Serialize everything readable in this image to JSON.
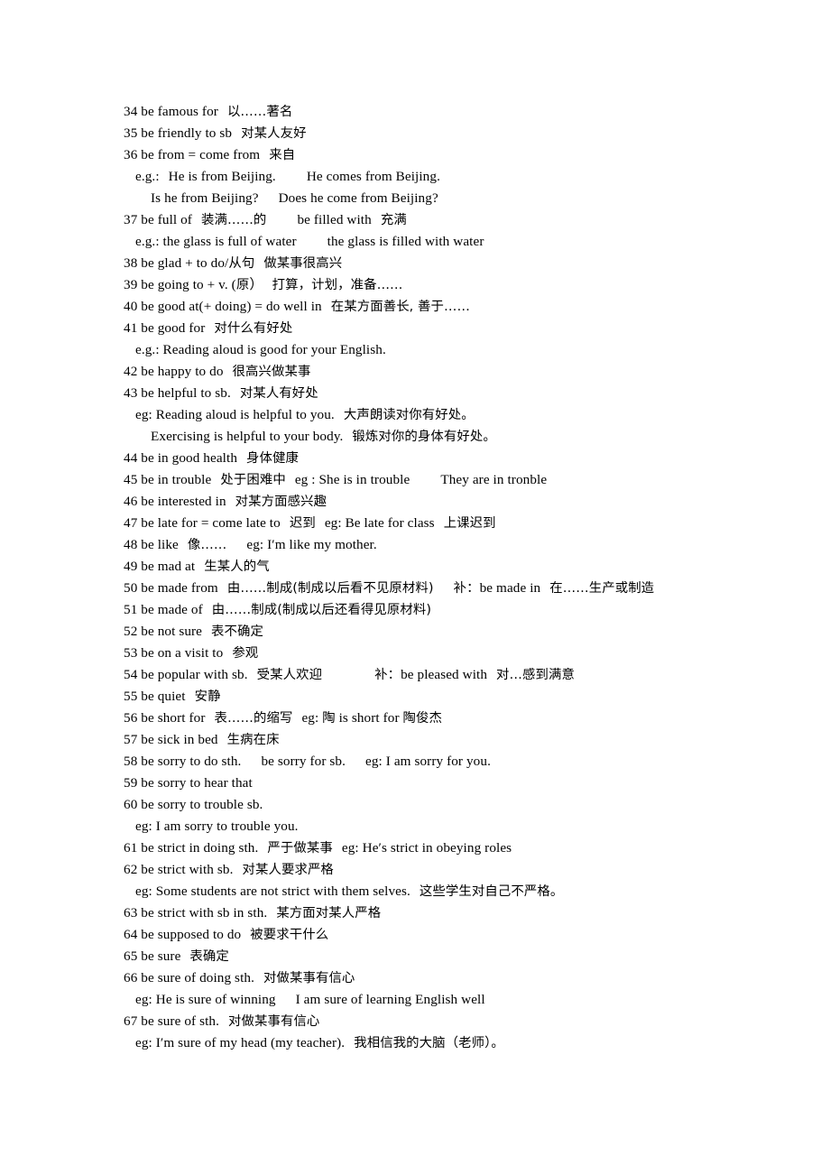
{
  "document": {
    "type": "english-chinese-phrase-list",
    "entries": [
      {
        "num": "34",
        "en": "be famous for",
        "zh": "以……著名"
      },
      {
        "num": "35",
        "en": "be friendly to sb",
        "zh": "对某人友好"
      },
      {
        "num": "36",
        "en": "be from = come from",
        "zh": "来自"
      },
      {
        "num": "37",
        "en": "be full of",
        "zh": "装满……的",
        "alt_en": "be filled with",
        "alt_zh": "充满"
      },
      {
        "num": "38",
        "en": "be glad + to do/从句",
        "zh": "做某事很高兴"
      },
      {
        "num": "39",
        "en": "be going to + v. (原）",
        "zh": "打算，计划，准备……"
      },
      {
        "num": "40",
        "en": "be good at(+ doing) = do well in",
        "zh": "在某方面善长, 善于……"
      },
      {
        "num": "41",
        "en": "be good for",
        "zh": "对什么有好处"
      },
      {
        "num": "42",
        "en": "be happy to do",
        "zh": "很高兴做某事"
      },
      {
        "num": "43",
        "en": "be helpful to sb.",
        "zh": "对某人有好处"
      },
      {
        "num": "44",
        "en": "be in good health",
        "zh": "身体健康"
      },
      {
        "num": "45",
        "en": "be in trouble",
        "zh": "处于困难中",
        "eg": "eg : She is in trouble",
        "eg2": "They are in tronble"
      },
      {
        "num": "46",
        "en": "be interested in",
        "zh": "对某方面感兴趣"
      },
      {
        "num": "47",
        "en": "be late for = come late to",
        "zh": "迟到",
        "eg": "eg: Be late for class",
        "eg_zh": "上课迟到"
      },
      {
        "num": "48",
        "en": "be like",
        "zh": "像……",
        "eg": "eg: I′m like my mother."
      },
      {
        "num": "49",
        "en": "be mad at",
        "zh": "生某人的气"
      },
      {
        "num": "50",
        "en": "be made from",
        "zh": "由……制成(制成以后看不见原材料)",
        "note": "补：be made in 在……生产或制造"
      },
      {
        "num": "51",
        "en": "be made of",
        "zh": "由……制成(制成以后还看得见原材料)"
      },
      {
        "num": "52",
        "en": "be not sure",
        "zh": "表不确定"
      },
      {
        "num": "53",
        "en": "be on a visit to",
        "zh": "参观"
      },
      {
        "num": "54",
        "en": "be popular with sb.",
        "zh": "受某人欢迎",
        "note": "补：be pleased with 对…感到满意"
      },
      {
        "num": "55",
        "en": "be quiet",
        "zh": "安静"
      },
      {
        "num": "56",
        "en": "be short for",
        "zh": "表……的缩写",
        "eg": "eg: 陶 is short for 陶俊杰"
      },
      {
        "num": "57",
        "en": "be sick in bed",
        "zh": "生病在床"
      },
      {
        "num": "58",
        "en": "be sorry to do sth.",
        "alt_en": "be sorry for sb.",
        "eg": "eg: I am sorry for you."
      },
      {
        "num": "59",
        "en": "be sorry to hear that"
      },
      {
        "num": "60",
        "en": "be sorry to trouble sb."
      },
      {
        "num": "61",
        "en": "be strict in doing sth.",
        "zh": "严于做某事",
        "eg": "eg: He′s strict in obeying roles"
      },
      {
        "num": "62",
        "en": "be strict with sb.",
        "zh": "对某人要求严格"
      },
      {
        "num": "63",
        "en": "be strict with sb in sth.",
        "zh": "某方面对某人严格"
      },
      {
        "num": "64",
        "en": "be supposed to do",
        "zh": "被要求干什么"
      },
      {
        "num": "65",
        "en": "be sure",
        "zh": "表确定"
      },
      {
        "num": "66",
        "en": "be sure of doing sth.",
        "zh": "对做某事有信心"
      },
      {
        "num": "67",
        "en": "be sure of sth.",
        "zh": "对做某事有信心"
      }
    ],
    "lines": [
      {
        "id": "l34",
        "indent": 0,
        "runs": [
          {
            "t": "34 be famous for"
          },
          {
            "g": "sm"
          },
          {
            "t": "以……著名",
            "cjk": true
          }
        ]
      },
      {
        "id": "l35",
        "indent": 0,
        "runs": [
          {
            "t": "35 be friendly to sb"
          },
          {
            "g": "sm"
          },
          {
            "t": "对某人友好",
            "cjk": true
          }
        ]
      },
      {
        "id": "l36",
        "indent": 0,
        "runs": [
          {
            "t": "36 be from = come from"
          },
          {
            "g": "sm"
          },
          {
            "t": "来自",
            "cjk": true
          }
        ]
      },
      {
        "id": "l36a",
        "indent": 1,
        "runs": [
          {
            "t": "e.g.:"
          },
          {
            "g": "sm"
          },
          {
            "t": "He is from Beijing."
          },
          {
            "g": "lg"
          },
          {
            "t": "He comes from Beijing."
          }
        ]
      },
      {
        "id": "l36b",
        "indent": 2,
        "runs": [
          {
            "t": "Is he from Beijing?"
          },
          {
            "g": "md"
          },
          {
            "t": "Does he come from Beijing?"
          }
        ]
      },
      {
        "id": "l37",
        "indent": 0,
        "runs": [
          {
            "t": "37 be full of"
          },
          {
            "g": "sm"
          },
          {
            "t": "装满……的",
            "cjk": true
          },
          {
            "g": "lg"
          },
          {
            "t": "be filled with"
          },
          {
            "g": "sm"
          },
          {
            "t": "充满",
            "cjk": true
          }
        ]
      },
      {
        "id": "l37a",
        "indent": 1,
        "runs": [
          {
            "t": "e.g.: the glass is full of water"
          },
          {
            "g": "lg"
          },
          {
            "t": "the glass is filled with water"
          }
        ]
      },
      {
        "id": "l38",
        "indent": 0,
        "runs": [
          {
            "t": "38 be glad + to do/"
          },
          {
            "t": "从句",
            "cjk": true
          },
          {
            "g": "sm"
          },
          {
            "t": "做某事很高兴",
            "cjk": true
          }
        ]
      },
      {
        "id": "l39",
        "indent": 0,
        "runs": [
          {
            "t": "39 be going to + v. ("
          },
          {
            "t": "原",
            "cjk": true
          },
          {
            "t": "）"
          },
          {
            "g": "sm"
          },
          {
            "t": "打算，计划，准备……",
            "cjk": true
          }
        ]
      },
      {
        "id": "l40",
        "indent": 0,
        "runs": [
          {
            "t": "40 be good at(+ doing) = do well in"
          },
          {
            "g": "sm"
          },
          {
            "t": "在某方面善长, 善于……",
            "cjk": true
          }
        ]
      },
      {
        "id": "l41",
        "indent": 0,
        "runs": [
          {
            "t": "41 be good for"
          },
          {
            "g": "sm"
          },
          {
            "t": "对什么有好处",
            "cjk": true
          }
        ]
      },
      {
        "id": "l41a",
        "indent": 1,
        "runs": [
          {
            "t": "e.g.: Reading aloud is good for your English."
          }
        ]
      },
      {
        "id": "l42",
        "indent": 0,
        "runs": [
          {
            "t": "42 be happy to do"
          },
          {
            "g": "sm"
          },
          {
            "t": "很高兴做某事",
            "cjk": true
          }
        ]
      },
      {
        "id": "l43",
        "indent": 0,
        "runs": [
          {
            "t": "43 be helpful to sb."
          },
          {
            "g": "sm"
          },
          {
            "t": "对某人有好处",
            "cjk": true
          }
        ]
      },
      {
        "id": "l43a",
        "indent": 1,
        "runs": [
          {
            "t": "eg: Reading aloud is helpful to you."
          },
          {
            "g": "sm"
          },
          {
            "t": "大声朗读对你有好处。",
            "cjk": true
          }
        ]
      },
      {
        "id": "l43b",
        "indent": 2,
        "runs": [
          {
            "t": "Exercising is helpful to your body."
          },
          {
            "g": "sm"
          },
          {
            "t": "锻炼对你的身体有好处。",
            "cjk": true
          }
        ]
      },
      {
        "id": "l44",
        "indent": 0,
        "runs": [
          {
            "t": "44 be in good health"
          },
          {
            "g": "sm"
          },
          {
            "t": "身体健康",
            "cjk": true
          }
        ]
      },
      {
        "id": "l45",
        "indent": 0,
        "runs": [
          {
            "t": "45 be in trouble"
          },
          {
            "g": "sm"
          },
          {
            "t": "处于困难中",
            "cjk": true
          },
          {
            "g": "sm"
          },
          {
            "t": "eg : She is in trouble"
          },
          {
            "g": "lg"
          },
          {
            "t": "They are in tronble"
          }
        ]
      },
      {
        "id": "l46",
        "indent": 0,
        "runs": [
          {
            "t": "46 be interested in"
          },
          {
            "g": "sm"
          },
          {
            "t": "对某方面感兴趣",
            "cjk": true
          }
        ]
      },
      {
        "id": "l47",
        "indent": 0,
        "runs": [
          {
            "t": "47 be late for = come late to"
          },
          {
            "g": "sm"
          },
          {
            "t": "迟到",
            "cjk": true
          },
          {
            "g": "sm"
          },
          {
            "t": "eg: Be late for class"
          },
          {
            "g": "sm"
          },
          {
            "t": "上课迟到",
            "cjk": true
          }
        ]
      },
      {
        "id": "l48",
        "indent": 0,
        "runs": [
          {
            "t": "48 be like"
          },
          {
            "g": "sm"
          },
          {
            "t": "像……",
            "cjk": true
          },
          {
            "g": "md"
          },
          {
            "t": "eg: I′m like my mother."
          }
        ]
      },
      {
        "id": "l49",
        "indent": 0,
        "runs": [
          {
            "t": "49 be mad at"
          },
          {
            "g": "sm"
          },
          {
            "t": "生某人的气",
            "cjk": true
          }
        ]
      },
      {
        "id": "l50",
        "indent": 0,
        "runs": [
          {
            "t": "50 be made from"
          },
          {
            "g": "sm"
          },
          {
            "t": "由……制成(制成以后看不见原材料)",
            "cjk": true
          },
          {
            "g": "md"
          },
          {
            "t": "补：",
            "cjk": true
          },
          {
            "t": "be made in"
          },
          {
            "g": "sm"
          },
          {
            "t": "在……生产或制造",
            "cjk": true
          }
        ]
      },
      {
        "id": "l51",
        "indent": 0,
        "runs": [
          {
            "t": "51 be made of"
          },
          {
            "g": "sm"
          },
          {
            "t": "由……制成(制成以后还看得见原材料)",
            "cjk": true
          }
        ]
      },
      {
        "id": "l52",
        "indent": 0,
        "runs": [
          {
            "t": "52 be not sure"
          },
          {
            "g": "sm"
          },
          {
            "t": "表不确定",
            "cjk": true
          }
        ]
      },
      {
        "id": "l53",
        "indent": 0,
        "runs": [
          {
            "t": "53 be on a visit to"
          },
          {
            "g": "sm"
          },
          {
            "t": "参观",
            "cjk": true
          }
        ]
      },
      {
        "id": "l54",
        "indent": 0,
        "runs": [
          {
            "t": "54 be popular with sb."
          },
          {
            "g": "sm"
          },
          {
            "t": "受某人欢迎",
            "cjk": true
          },
          {
            "g": "xl"
          },
          {
            "t": "补：",
            "cjk": true
          },
          {
            "t": "be pleased with"
          },
          {
            "g": "sm"
          },
          {
            "t": "对…感到满意",
            "cjk": true
          }
        ]
      },
      {
        "id": "l55",
        "indent": 0,
        "runs": [
          {
            "t": "55 be quiet"
          },
          {
            "g": "sm"
          },
          {
            "t": "安静",
            "cjk": true
          }
        ]
      },
      {
        "id": "l56",
        "indent": 0,
        "runs": [
          {
            "t": "56 be short for"
          },
          {
            "g": "sm"
          },
          {
            "t": "表……的缩写",
            "cjk": true
          },
          {
            "g": "sm"
          },
          {
            "t": "eg: "
          },
          {
            "t": "陶",
            "cjk": true
          },
          {
            "t": " is short for "
          },
          {
            "t": "陶俊杰",
            "cjk": true
          }
        ]
      },
      {
        "id": "l57",
        "indent": 0,
        "runs": [
          {
            "t": "57 be sick in bed"
          },
          {
            "g": "sm"
          },
          {
            "t": "生病在床",
            "cjk": true
          }
        ]
      },
      {
        "id": "l58",
        "indent": 0,
        "runs": [
          {
            "t": "58 be sorry to do sth."
          },
          {
            "g": "md"
          },
          {
            "t": "be sorry for sb."
          },
          {
            "g": "md"
          },
          {
            "t": "eg: I am sorry for you."
          }
        ]
      },
      {
        "id": "l59",
        "indent": 0,
        "runs": [
          {
            "t": "59 be sorry to hear that"
          }
        ]
      },
      {
        "id": "l60",
        "indent": 0,
        "runs": [
          {
            "t": "60 be sorry to trouble sb."
          }
        ]
      },
      {
        "id": "l60a",
        "indent": 1,
        "runs": [
          {
            "t": "eg: I am sorry to trouble you."
          }
        ]
      },
      {
        "id": "l61",
        "indent": 0,
        "runs": [
          {
            "t": "61 be strict in doing sth."
          },
          {
            "g": "sm"
          },
          {
            "t": "严于做某事",
            "cjk": true
          },
          {
            "g": "sm"
          },
          {
            "t": "eg: He′s strict in obeying roles"
          }
        ]
      },
      {
        "id": "l62",
        "indent": 0,
        "runs": [
          {
            "t": "62 be strict with sb."
          },
          {
            "g": "sm"
          },
          {
            "t": "对某人要求严格",
            "cjk": true
          }
        ]
      },
      {
        "id": "l62a",
        "indent": 1,
        "runs": [
          {
            "t": "eg: Some students are not strict with them selves."
          },
          {
            "g": "sm"
          },
          {
            "t": "这些学生对自己不严格。",
            "cjk": true
          }
        ]
      },
      {
        "id": "l63",
        "indent": 0,
        "runs": [
          {
            "t": "63 be strict with sb in sth."
          },
          {
            "g": "sm"
          },
          {
            "t": "某方面对某人严格",
            "cjk": true
          }
        ]
      },
      {
        "id": "l64",
        "indent": 0,
        "runs": [
          {
            "t": "64 be supposed to do"
          },
          {
            "g": "sm"
          },
          {
            "t": "被要求干什么",
            "cjk": true
          }
        ]
      },
      {
        "id": "l65",
        "indent": 0,
        "runs": [
          {
            "t": "65 be sure"
          },
          {
            "g": "sm"
          },
          {
            "t": "表确定",
            "cjk": true
          }
        ]
      },
      {
        "id": "l66",
        "indent": 0,
        "runs": [
          {
            "t": "66 be sure of doing sth."
          },
          {
            "g": "sm"
          },
          {
            "t": "对做某事有信心",
            "cjk": true
          }
        ]
      },
      {
        "id": "l66a",
        "indent": 1,
        "runs": [
          {
            "t": "eg: He is sure of winning"
          },
          {
            "g": "md"
          },
          {
            "t": "I am sure of learning English well"
          }
        ]
      },
      {
        "id": "l67",
        "indent": 0,
        "runs": [
          {
            "t": "67 be sure of sth."
          },
          {
            "g": "sm"
          },
          {
            "t": "对做某事有信心",
            "cjk": true
          }
        ]
      },
      {
        "id": "l67a",
        "indent": 1,
        "runs": [
          {
            "t": "eg: I′m sure of my head (my teacher)."
          },
          {
            "g": "sm"
          },
          {
            "t": "我相信我的大脑（老师）。",
            "cjk": true
          }
        ]
      }
    ]
  }
}
